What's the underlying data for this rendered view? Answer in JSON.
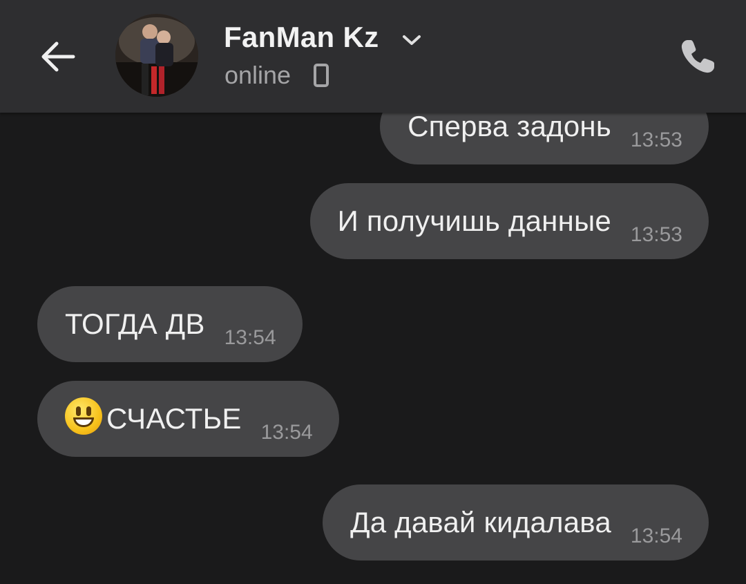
{
  "header": {
    "contact_name": "FanMan Kz",
    "status": "online",
    "back_icon": "back-arrow-icon",
    "call_icon": "phone-icon",
    "device_icon": "mobile-device-icon"
  },
  "messages": [
    {
      "text": "Сперва задонь",
      "time": "13:53",
      "direction": "outgoing"
    },
    {
      "text": "И получишь данные",
      "time": "13:53",
      "direction": "outgoing"
    },
    {
      "text": "ТОГДА ДВ",
      "time": "13:54",
      "direction": "incoming"
    },
    {
      "text": "СЧАСТЬЕ",
      "time": "13:54",
      "direction": "incoming",
      "emoji": "smiley-emoji"
    },
    {
      "text": "Да давай кидалава",
      "time": "13:54",
      "direction": "outgoing"
    }
  ],
  "colors": {
    "background": "#1a1a1b",
    "header": "#2e2e30",
    "bubble": "#454547",
    "text": "#f0f0f0",
    "timestamp": "#9a9a9c"
  }
}
